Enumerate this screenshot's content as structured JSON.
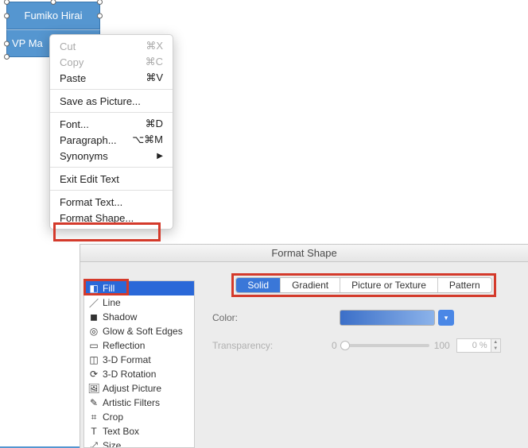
{
  "shape": {
    "name": "Fumiko Hirai",
    "role": "VP Ma"
  },
  "ctx": {
    "cut": "Cut",
    "cut_sc": "⌘X",
    "copy": "Copy",
    "copy_sc": "⌘C",
    "paste": "Paste",
    "paste_sc": "⌘V",
    "save_pic": "Save as Picture...",
    "font": "Font...",
    "font_sc": "⌘D",
    "para": "Paragraph...",
    "para_sc": "⌥⌘M",
    "syn": "Synonyms",
    "exit": "Exit Edit Text",
    "fmt_text": "Format Text...",
    "fmt_shape": "Format Shape..."
  },
  "window": {
    "title": "Format Shape"
  },
  "sidebar": [
    {
      "icon": "fill-icon",
      "glyph": "◧",
      "label": "Fill"
    },
    {
      "icon": "line-icon",
      "glyph": "／",
      "label": "Line"
    },
    {
      "icon": "shadow-icon",
      "glyph": "◼",
      "label": "Shadow"
    },
    {
      "icon": "glow-icon",
      "glyph": "◎",
      "label": "Glow & Soft Edges"
    },
    {
      "icon": "reflection-icon",
      "glyph": "▭",
      "label": "Reflection"
    },
    {
      "icon": "3d-format-icon",
      "glyph": "◫",
      "label": "3-D Format"
    },
    {
      "icon": "3d-rotation-icon",
      "glyph": "⟳",
      "label": "3-D Rotation"
    },
    {
      "icon": "adjust-picture-icon",
      "glyph": "🖼",
      "label": "Adjust Picture"
    },
    {
      "icon": "artistic-filters-icon",
      "glyph": "✎",
      "label": "Artistic Filters"
    },
    {
      "icon": "crop-icon",
      "glyph": "⌗",
      "label": "Crop"
    },
    {
      "icon": "text-box-icon",
      "glyph": "T",
      "label": "Text Box"
    },
    {
      "icon": "size-icon",
      "glyph": "⤢",
      "label": "Size"
    }
  ],
  "tabs": {
    "solid": "Solid",
    "gradient": "Gradient",
    "picture": "Picture or Texture",
    "pattern": "Pattern"
  },
  "form": {
    "color_label": "Color:",
    "transparency_label": "Transparency:",
    "trans_min": "0",
    "trans_max": "100",
    "trans_value": "0 %"
  }
}
